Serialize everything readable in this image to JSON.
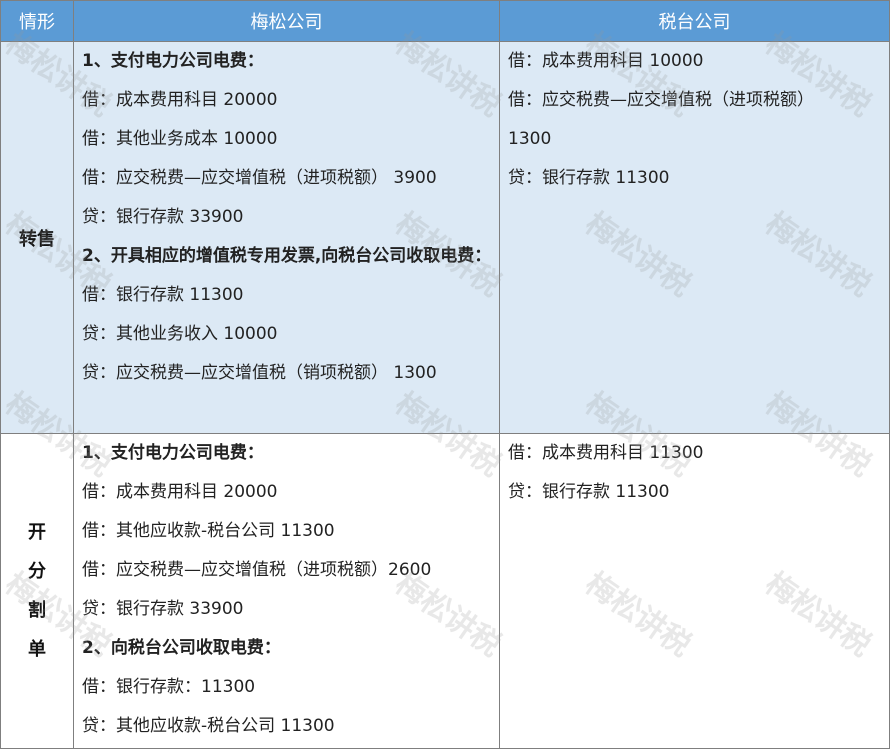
{
  "header": {
    "col1": "情形",
    "col2": "梅松公司",
    "col3": "税台公司"
  },
  "transfer": {
    "label": "转售",
    "meisong": [
      {
        "text": "1、支付电力公司电费：",
        "bold": true
      },
      {
        "text": "借：成本费用科目    20000"
      },
      {
        "text": "借：其他业务成本  10000"
      },
      {
        "text": "借：应交税费—应交增值税（进项税额）  3900"
      },
      {
        "text": "贷：银行存款    33900"
      },
      {
        "text": "2、开具相应的增值税专用发票,向税台公司收取电费：",
        "bold": true,
        "wrap": true
      },
      {
        "text": "借：银行存款      11300"
      },
      {
        "text": "贷：其他业务收入    10000"
      },
      {
        "text": "贷：应交税费—应交增值税（销项税额）  1300"
      }
    ],
    "shuitai": [
      {
        "text": "借：成本费用科目      10000"
      },
      {
        "text": "借：应交税费—应交增值税（进项税额）"
      },
      {
        "text": "1300",
        "flush": true
      },
      {
        "text": "贷：银行存款      11300"
      }
    ]
  },
  "split": {
    "label_chars": [
      "开",
      "分",
      "割",
      "单"
    ],
    "meisong": [
      {
        "text": "1、支付电力公司电费：",
        "bold": true
      },
      {
        "text": "借：成本费用科目    20000"
      },
      {
        "text": "借：其他应收款-税台公司  11300"
      },
      {
        "text": "借：应交税费—应交增值税（进项税额）2600"
      },
      {
        "text": "贷：银行存款      33900"
      },
      {
        "text": "2、向税台公司收取电费：",
        "bold": true
      },
      {
        "text": "借：银行存款：11300"
      },
      {
        "text": "贷：其他应收款-税台公司  11300"
      }
    ],
    "shuitai": [
      {
        "text": "借：成本费用科目    11300"
      },
      {
        "text": "贷：银行存款      11300"
      }
    ]
  },
  "watermark": {
    "text": "梅松讲税"
  }
}
